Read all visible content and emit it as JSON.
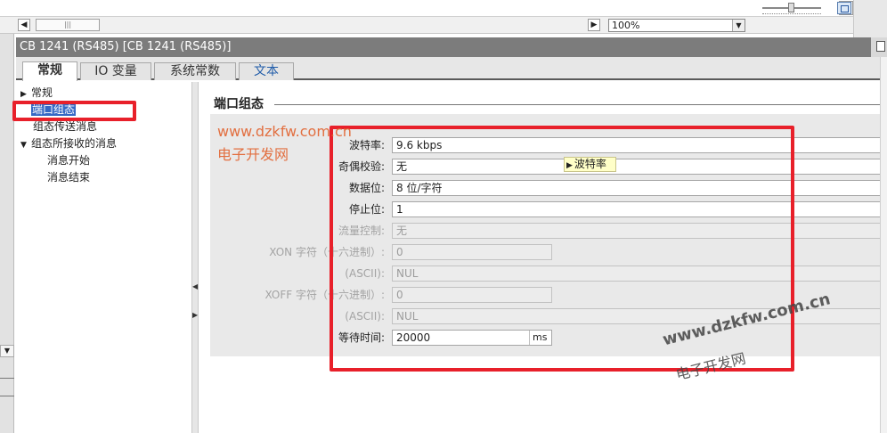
{
  "toolbar": {
    "zoom_value": "100%",
    "scroll_thumb_grip": "|||"
  },
  "window": {
    "title": "CB 1241 (RS485) [CB 1241 (RS485)]"
  },
  "tabs": [
    {
      "label": "常规",
      "active": true
    },
    {
      "label": "IO 变量",
      "active": false
    },
    {
      "label": "系统常数",
      "active": false
    },
    {
      "label": "文本",
      "active": false
    }
  ],
  "tree": {
    "items": [
      {
        "label": "常规",
        "arrow": "▶"
      },
      {
        "label": "端口组态",
        "selected": true
      },
      {
        "label": "组态传送消息"
      },
      {
        "label": "组态所接收的消息",
        "arrow": "▼"
      },
      {
        "label": "消息开始"
      },
      {
        "label": "消息结束"
      }
    ]
  },
  "section": {
    "title": "端口组态"
  },
  "form": {
    "baud_rate": {
      "label": "波特率:",
      "value": "9.6 kbps"
    },
    "parity": {
      "label": "奇偶校验:",
      "value": "无"
    },
    "data_bits": {
      "label": "数据位:",
      "value": "8 位/字符"
    },
    "stop_bits": {
      "label": "停止位:",
      "value": "1"
    },
    "flow_control": {
      "label": "流量控制:",
      "value": "无"
    },
    "xon_hex": {
      "label": "XON 字符（十六进制）:",
      "value": "0"
    },
    "xon_ascii": {
      "label": "(ASCII):",
      "value": "NUL"
    },
    "xoff_hex": {
      "label": "XOFF 字符（十六进制）:",
      "value": "0"
    },
    "xoff_ascii": {
      "label": "(ASCII):",
      "value": "NUL"
    },
    "wait_time": {
      "label": "等待时间:",
      "value": "20000",
      "unit": "ms"
    }
  },
  "tooltip": {
    "text": "波特率"
  },
  "watermark": {
    "url": "www.dzkfw.com.cn",
    "name": "电子开发网"
  },
  "colors": {
    "annotation_red": "#e8202a",
    "selection_blue": "#3568c4",
    "title_bar": "#7c7c7c",
    "watermark_orange": "#e2622e"
  }
}
